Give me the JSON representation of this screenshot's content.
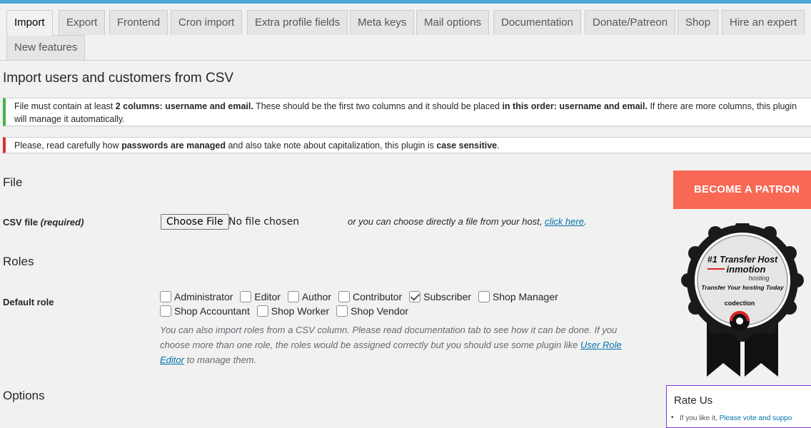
{
  "tabs": [
    {
      "label": "Import",
      "active": true
    },
    {
      "label": "Export"
    },
    {
      "label": "Frontend"
    },
    {
      "label": "Cron import"
    },
    {
      "label": "Extra profile fields"
    },
    {
      "label": "Meta keys"
    },
    {
      "label": "Mail options"
    },
    {
      "label": "Documentation"
    },
    {
      "label": "Donate/Patreon"
    },
    {
      "label": "Shop"
    },
    {
      "label": "Hire an expert"
    },
    {
      "label": "New features"
    }
  ],
  "page_title": "Import users and customers from CSV",
  "notices": {
    "columns": {
      "t1": "File must contain at least ",
      "b1": "2 columns: username and email.",
      "t2": " These should be the first two columns and it should be placed ",
      "b2": "in this order: username and email.",
      "t3": " If there are more columns, this plugin will manage it automatically."
    },
    "passwords": {
      "t1": "Please, read carefully how ",
      "b1": "passwords are managed",
      "t2": " and also take note about capitalization, this plugin is ",
      "b2": "case sensitive",
      "t3": "."
    }
  },
  "file_section": {
    "heading": "File",
    "label": "CSV file",
    "label_required": "(required)",
    "button": "Choose File",
    "status": "No file chosen",
    "host_text": "or you can choose directly a file from your host, ",
    "host_link": "click here",
    "host_end": "."
  },
  "roles_section": {
    "heading": "Roles",
    "label": "Default role",
    "roles": [
      {
        "label": "Administrator",
        "checked": false
      },
      {
        "label": "Editor",
        "checked": false
      },
      {
        "label": "Author",
        "checked": false
      },
      {
        "label": "Contributor",
        "checked": false
      },
      {
        "label": "Subscriber",
        "checked": true
      },
      {
        "label": "Shop Manager",
        "checked": false
      },
      {
        "label": "Shop Accountant",
        "checked": false
      },
      {
        "label": "Shop Worker",
        "checked": false
      },
      {
        "label": "Shop Vendor",
        "checked": false
      }
    ],
    "desc_text": "You can also import roles from a CSV column. Please read documentation tab to see how it can be done. If you choose more than one role, the roles would be assigned correctly but you should use some plugin like ",
    "desc_link": "User Role Editor",
    "desc_end": " to manage them."
  },
  "options_heading": "Options",
  "sidebar": {
    "patron_button": "BECOME A PATRON",
    "badge": {
      "line1": "#1 Transfer Host",
      "brand": "inmotion",
      "brand_sub": "hosting",
      "line2": "Transfer Your hosting Today",
      "partner": "codection"
    },
    "rate": {
      "title": "Rate Us",
      "item_text": "If you like it, ",
      "item_link": "Please vote and suppo"
    }
  },
  "colors": {
    "accent": "#0073aa",
    "success": "#46b450",
    "error": "#dc3232",
    "patron": "#f96854",
    "topbar": "#50a8d8"
  }
}
